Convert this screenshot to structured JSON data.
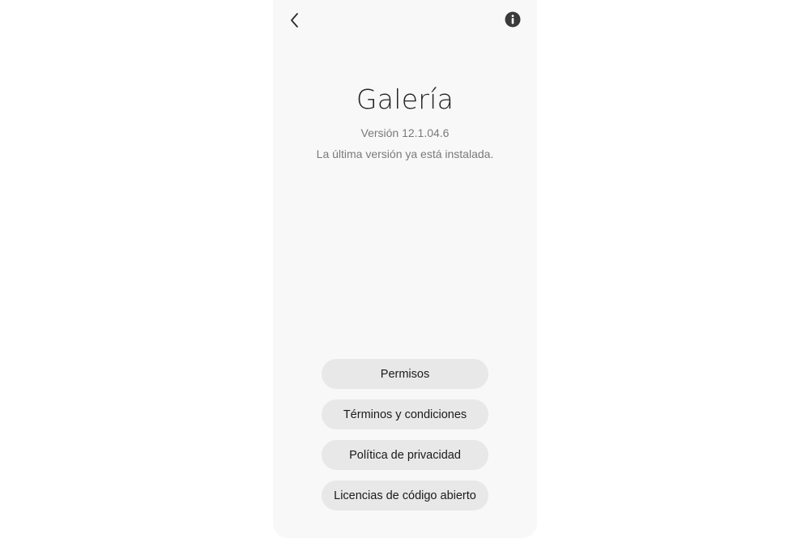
{
  "header": {
    "back_icon": "chevron-left-icon",
    "info_icon": "info-circle-icon"
  },
  "app": {
    "title": "Galería",
    "version": "Versión 12.1.04.6",
    "status": "La última versión ya está instalada."
  },
  "buttons": {
    "permissions": "Permisos",
    "terms": "Términos y condiciones",
    "privacy": "Política de privacidad",
    "licenses": "Licencias de código abierto"
  },
  "colors": {
    "screen_background": "#f8f8f8",
    "button_background": "#e8e8e8",
    "secondary_text": "#7a7a7a"
  }
}
